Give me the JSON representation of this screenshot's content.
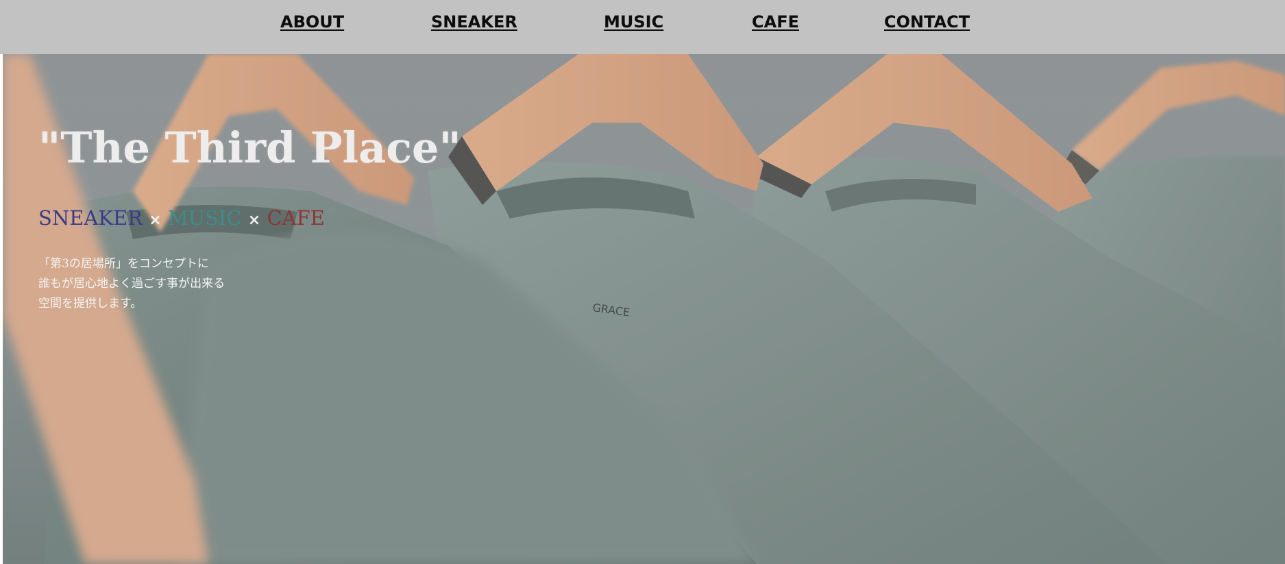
{
  "nav": {
    "items": [
      {
        "label": "ABOUT"
      },
      {
        "label": "SNEAKER"
      },
      {
        "label": "MUSIC"
      },
      {
        "label": "CAFE"
      },
      {
        "label": "CONTACT"
      }
    ],
    "background": "#c2c2c2"
  },
  "hero": {
    "title": "\"The Third Place\"",
    "tagline": {
      "sneaker": "SNEAKER",
      "separator": "×",
      "music": "MUSIC",
      "cafe": "CAFE",
      "colors": {
        "sneaker": "#3a3a86",
        "music": "#3b8f8b",
        "cafe": "#8e3434"
      }
    },
    "description": [
      "「第3の居場所」をコンセプトに",
      "誰もが居心地よく過ごす事が出来る",
      "空間を提供します。"
    ],
    "image": {
      "subject": "t-shirts-on-hangers-photo",
      "shirt_label": "GRACE"
    }
  }
}
